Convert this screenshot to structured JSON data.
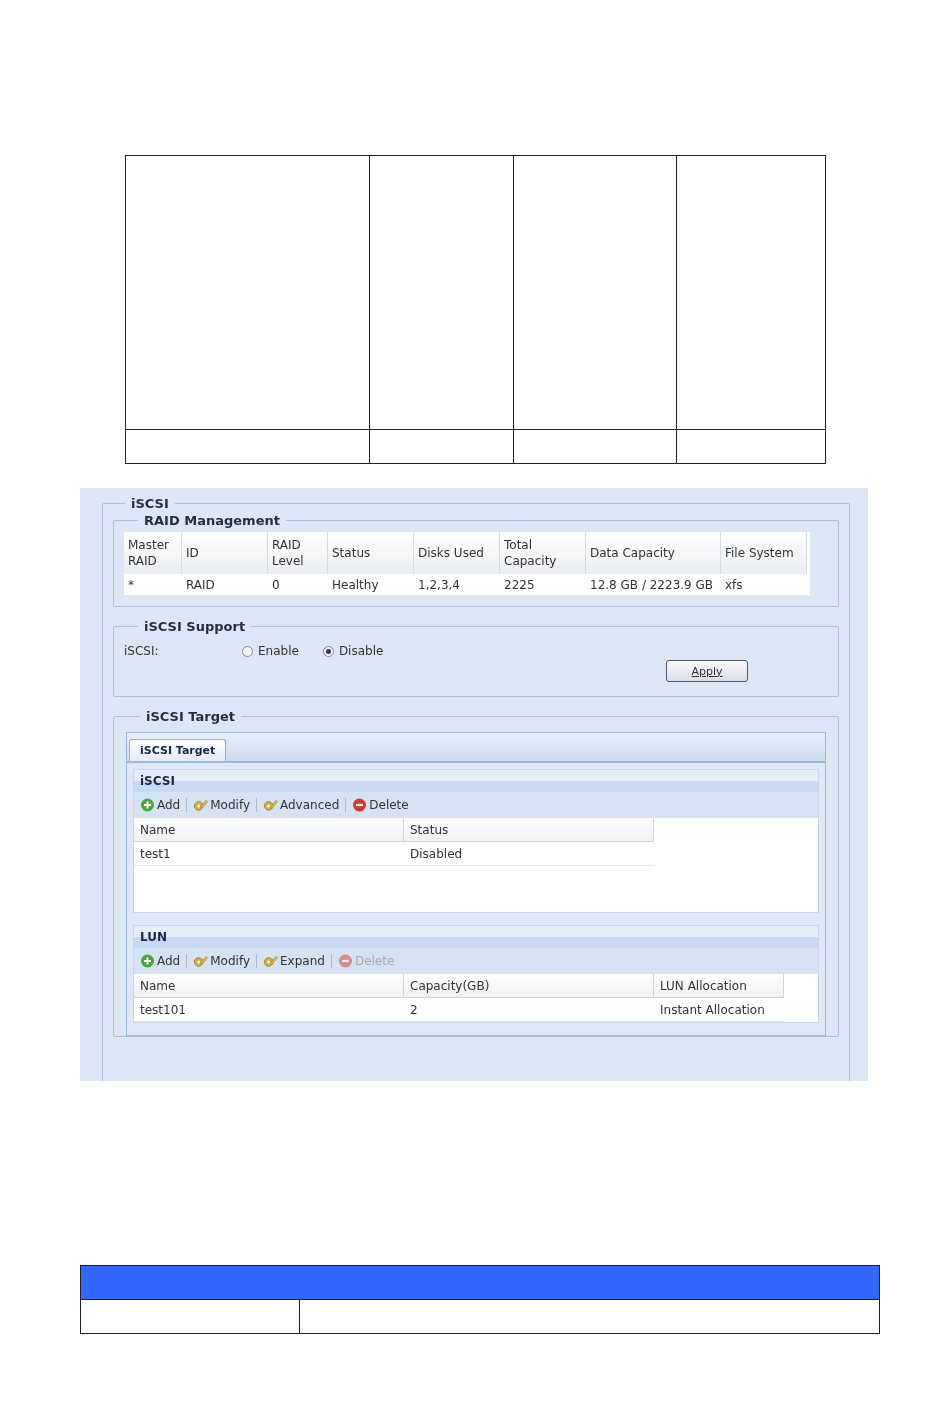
{
  "screenshot": {
    "section_title": "iSCSI",
    "raid_management": {
      "title": "RAID Management",
      "columns": [
        "Master RAID",
        "ID",
        "RAID Level",
        "Status",
        "Disks Used",
        "Total Capacity",
        "Data Capacity",
        "File System"
      ],
      "rows": [
        [
          "*",
          "RAID",
          "0",
          "Healthy",
          "1,2,3,4",
          "2225",
          "12.8 GB / 2223.9 GB",
          "xfs"
        ]
      ]
    },
    "iscsi_support": {
      "title": "iSCSI Support",
      "label": "iSCSI:",
      "options": [
        {
          "label": "Enable",
          "selected": false
        },
        {
          "label": "Disable",
          "selected": true
        }
      ],
      "apply_button": "Apply"
    },
    "iscsi_target": {
      "title": "iSCSI Target",
      "tabs": [
        {
          "label": "iSCSI Target",
          "selected": true
        }
      ],
      "panels": [
        {
          "title": "iSCSI",
          "toolbar": [
            {
              "kind": "add",
              "label": "Add",
              "disabled": false
            },
            {
              "kind": "edit",
              "label": "Modify",
              "disabled": false
            },
            {
              "kind": "edit",
              "label": "Advanced",
              "disabled": false
            },
            {
              "kind": "delete",
              "label": "Delete",
              "disabled": false
            }
          ],
          "columns": [
            "Name",
            "Status"
          ],
          "rows": [
            [
              "test1",
              "Disabled"
            ]
          ]
        },
        {
          "title": "LUN",
          "toolbar": [
            {
              "kind": "add",
              "label": "Add",
              "disabled": false
            },
            {
              "kind": "edit",
              "label": "Modify",
              "disabled": false
            },
            {
              "kind": "edit",
              "label": "Expand",
              "disabled": false
            },
            {
              "kind": "delete",
              "label": "Delete",
              "disabled": true
            }
          ],
          "columns": [
            "Name",
            "Capacity(GB)",
            "LUN Allocation"
          ],
          "rows": [
            [
              "test101",
              "2",
              "Instant Allocation"
            ]
          ]
        }
      ]
    }
  }
}
